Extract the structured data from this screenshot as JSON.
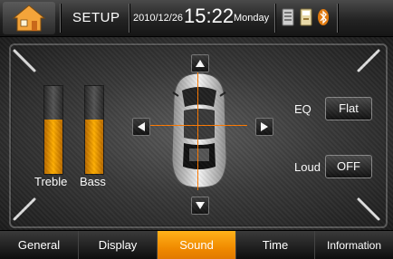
{
  "status_bar": {
    "title": "SETUP",
    "date": "2010/12/26",
    "time": "15:22",
    "day": "Monday",
    "icons": [
      "sd-card-icon",
      "usb-icon",
      "bluetooth-icon"
    ]
  },
  "sound": {
    "sliders": [
      {
        "label": "Treble",
        "level": 0.62
      },
      {
        "label": "Bass",
        "level": 0.62
      }
    ],
    "eq_label": "EQ",
    "eq_value": "Flat",
    "loud_label": "Loud",
    "loud_value": "OFF",
    "balance_arrows": [
      "arrow-up",
      "arrow-left",
      "arrow-right",
      "arrow-down"
    ]
  },
  "tabs": [
    {
      "label": "General",
      "active": false
    },
    {
      "label": "Display",
      "active": false
    },
    {
      "label": "Sound",
      "active": true
    },
    {
      "label": "Time",
      "active": false
    },
    {
      "label": "Information",
      "active": false
    }
  ],
  "colors": {
    "accent": "#f59a00",
    "level_fill": "#ffae00",
    "crosshair": "#ff7a00"
  }
}
